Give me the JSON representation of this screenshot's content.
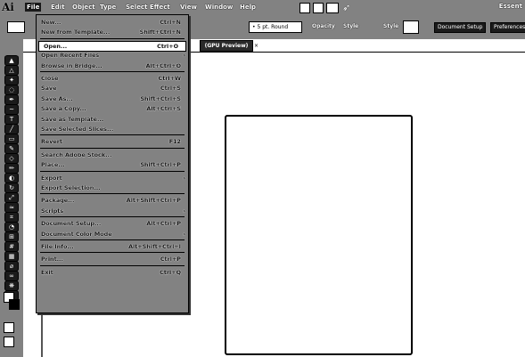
{
  "app": {
    "logo": "Ai"
  },
  "menubar": {
    "items": [
      "File",
      "Edit",
      "Object",
      "Type",
      "Select",
      "Effect",
      "View",
      "Window",
      "Help"
    ],
    "active": "File",
    "icons": [
      "bridge-icon",
      "stock-icon",
      "arrange-icon",
      "rocket-icon"
    ],
    "user": "Essent"
  },
  "controlbar": {
    "stroke_profile": "5 pt. Round",
    "opacity_label": "Opacity",
    "style_label": "Style",
    "style2_label": "Style",
    "document_setup": "Document Setup",
    "preferences": "Preferences"
  },
  "document_tab": {
    "label": "(GPU Preview)",
    "close": "×"
  },
  "file_menu": {
    "items": [
      {
        "label": "New...",
        "shortcut": "Ctrl+N"
      },
      {
        "label": "New from Template...",
        "shortcut": "Shift+Ctrl+N"
      },
      {
        "label": "Open...",
        "shortcut": "Ctrl+O"
      },
      {
        "label": "Open Recent Files",
        "shortcut": "",
        "submenu": true
      },
      {
        "label": "Browse in Bridge...",
        "shortcut": "Alt+Ctrl+O"
      },
      {
        "label": "Close",
        "shortcut": "Ctrl+W"
      },
      {
        "label": "Save",
        "shortcut": "Ctrl+S"
      },
      {
        "label": "Save As...",
        "shortcut": "Shift+Ctrl+S"
      },
      {
        "label": "Save a Copy...",
        "shortcut": "Alt+Ctrl+S"
      },
      {
        "label": "Save as Template...",
        "shortcut": ""
      },
      {
        "label": "Save Selected Slices...",
        "shortcut": ""
      },
      {
        "label": "Revert",
        "shortcut": "F12"
      },
      {
        "label": "Search Adobe Stock...",
        "shortcut": ""
      },
      {
        "label": "Place...",
        "shortcut": "Shift+Ctrl+P"
      },
      {
        "label": "Export",
        "shortcut": "",
        "submenu": true
      },
      {
        "label": "Export Selection...",
        "shortcut": ""
      },
      {
        "label": "Package...",
        "shortcut": "Alt+Shift+Ctrl+P"
      },
      {
        "label": "Scripts",
        "shortcut": "",
        "submenu": true
      },
      {
        "label": "Document Setup...",
        "shortcut": "Alt+Ctrl+P"
      },
      {
        "label": "Document Color Mode",
        "shortcut": "",
        "submenu": true
      },
      {
        "label": "File Info...",
        "shortcut": "Alt+Shift+Ctrl+I"
      },
      {
        "label": "Print...",
        "shortcut": "Ctrl+P"
      },
      {
        "label": "Exit",
        "shortcut": "Ctrl+Q"
      }
    ]
  },
  "toolbar": {
    "tools": [
      "selection-tool",
      "direct-selection-tool",
      "magic-wand-tool",
      "lasso-tool",
      "pen-tool",
      "curvature-tool",
      "type-tool",
      "line-tool",
      "rectangle-tool",
      "paintbrush-tool",
      "shaper-tool",
      "pencil-tool",
      "eraser-tool",
      "rotate-tool",
      "scale-tool",
      "width-tool",
      "free-transform-tool",
      "shape-builder-tool",
      "perspective-grid-tool",
      "mesh-tool",
      "gradient-tool",
      "eyedropper-tool",
      "blend-tool",
      "symbol-sprayer-tool",
      "column-graph-tool"
    ]
  }
}
